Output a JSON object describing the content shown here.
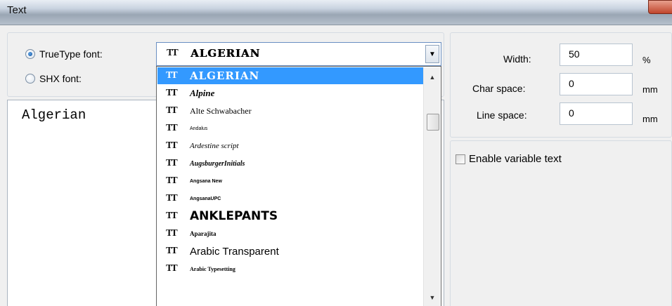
{
  "window": {
    "title": "Text"
  },
  "font_source": {
    "truetype_label": "TrueType font:",
    "shx_label": "SHX font:",
    "selected": "truetype"
  },
  "font_combo": {
    "value": "ALGERIAN",
    "icon": "truetype-icon",
    "icon_glyph": "TT"
  },
  "text_content": "Algerian",
  "font_list": [
    {
      "name": "ALGERIAN",
      "selected": true,
      "family": "DejaVu Serif",
      "size": 15,
      "weight": "bold",
      "style": "normal"
    },
    {
      "name": "Alpine",
      "selected": false,
      "family": "Liberation Serif",
      "size": 13,
      "weight": "bold",
      "style": "italic"
    },
    {
      "name": "Alte Schwabacher",
      "selected": false,
      "family": "Liberation Serif",
      "size": 12,
      "weight": "normal",
      "style": "normal"
    },
    {
      "name": "Andalus",
      "selected": false,
      "family": "Liberation Sans",
      "size": 7,
      "weight": "normal",
      "style": "normal"
    },
    {
      "name": "Ardestine script",
      "selected": false,
      "family": "Liberation Serif",
      "size": 11,
      "weight": "normal",
      "style": "italic"
    },
    {
      "name": "AugsburgerInitials",
      "selected": false,
      "family": "Liberation Serif",
      "size": 10,
      "weight": "bold",
      "style": "italic"
    },
    {
      "name": "Angsana New",
      "selected": false,
      "family": "Liberation Sans",
      "size": 7,
      "weight": "bold",
      "style": "normal"
    },
    {
      "name": "AngsanaUPC",
      "selected": false,
      "family": "Liberation Sans",
      "size": 7,
      "weight": "bold",
      "style": "normal"
    },
    {
      "name": "ANKLEPANTS",
      "selected": false,
      "family": "DejaVu Sans",
      "size": 17,
      "weight": "bold",
      "style": "normal"
    },
    {
      "name": "Aparajita",
      "selected": false,
      "family": "Liberation Serif",
      "size": 9,
      "weight": "bold",
      "style": "normal"
    },
    {
      "name": "Arabic Transparent",
      "selected": false,
      "family": "Liberation Sans",
      "size": 15,
      "weight": "normal",
      "style": "normal"
    },
    {
      "name": "Arabic Typesetting",
      "selected": false,
      "family": "Liberation Serif",
      "size": 8,
      "weight": "bold",
      "style": "normal"
    }
  ],
  "dimensions": {
    "width_label": "Width:",
    "width_value": "50",
    "width_unit": "%",
    "char_space_label": "Char space:",
    "char_space_value": "0",
    "char_space_unit": "mm",
    "line_space_label": "Line space:",
    "line_space_value": "0",
    "line_space_unit": "mm"
  },
  "variable_text": {
    "label": "Enable variable text",
    "checked": false
  },
  "colors": {
    "selection": "#3399ff",
    "combo_border": "#6a8fc2",
    "dialog_bg": "#f0f0f0"
  }
}
